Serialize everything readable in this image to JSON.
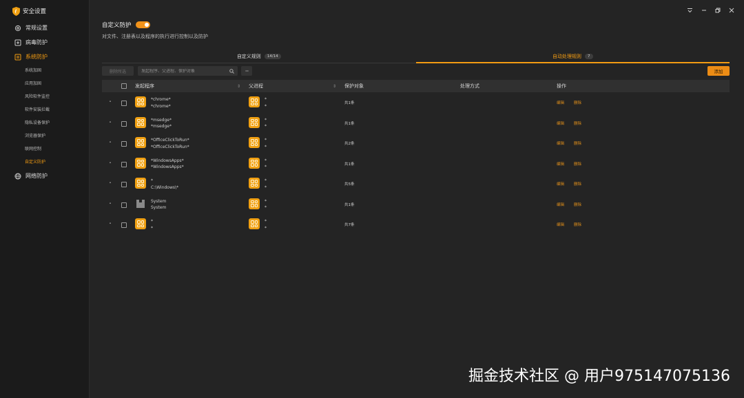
{
  "app": {
    "title": "安全设置",
    "brand_color": "#f39c12"
  },
  "sidebar": {
    "items": [
      {
        "label": "常规设置",
        "icon": "gear-icon"
      },
      {
        "label": "病毒防护",
        "icon": "plus-box-icon"
      },
      {
        "label": "系统防护",
        "icon": "shield-box-icon",
        "active": true
      },
      {
        "label": "网络防护",
        "icon": "globe-icon"
      }
    ],
    "sub_items": [
      {
        "label": "系统加固"
      },
      {
        "label": "应用加固"
      },
      {
        "label": "风险软件监控"
      },
      {
        "label": "软件安装拦截"
      },
      {
        "label": "隐私设备保护"
      },
      {
        "label": "浏览器保护"
      },
      {
        "label": "联网控制"
      },
      {
        "label": "自定义防护",
        "active": true
      }
    ]
  },
  "header": {
    "title": "自定义防护",
    "toggle_on": true,
    "description": "对文件、注册表以及程序的执行进行控制以及防护"
  },
  "tabs": [
    {
      "label": "自定义规则",
      "badge": "14/14"
    },
    {
      "label": "自动处理规则",
      "badge": "7",
      "active": true
    }
  ],
  "toolbar": {
    "delete_label": "删除所选",
    "search_placeholder": "发起程序、父进程、保护对象",
    "more_label": "···",
    "add_label": "添加"
  },
  "table": {
    "columns": [
      "发起程序",
      "父进程",
      "保护对象",
      "处理方式",
      "操作"
    ],
    "rows": [
      {
        "proc": [
          "*chrome*",
          "*chrome*"
        ],
        "parent": [
          "*",
          "*"
        ],
        "count": "共1条",
        "icon": "app-grid-icon"
      },
      {
        "proc": [
          "*msedge*",
          "*msedge*"
        ],
        "parent": [
          "*",
          "*"
        ],
        "count": "共1条",
        "icon": "app-grid-icon"
      },
      {
        "proc": [
          "*OfficeClickToRun*",
          "*OfficeClickToRun*"
        ],
        "parent": [
          "*",
          "*"
        ],
        "count": "共2条",
        "icon": "app-grid-icon"
      },
      {
        "proc": [
          "*WindowsApps*",
          "*WindowsApps*"
        ],
        "parent": [
          "*",
          "*"
        ],
        "count": "共1条",
        "icon": "app-grid-icon"
      },
      {
        "proc": [
          "*",
          "C:\\Windows\\*"
        ],
        "parent": [
          "*",
          "*"
        ],
        "count": "共5条",
        "icon": "app-grid-icon"
      },
      {
        "proc": [
          "System",
          "System"
        ],
        "parent": [
          "*",
          "*"
        ],
        "count": "共1条",
        "icon": "system-icon"
      },
      {
        "proc": [
          "*",
          "*"
        ],
        "parent": [
          "*",
          "*"
        ],
        "count": "共7条",
        "icon": "app-grid-icon"
      }
    ],
    "edit_label": "编辑",
    "delete_label": "删除"
  },
  "watermark": "掘金技术社区 @ 用户975147075136"
}
